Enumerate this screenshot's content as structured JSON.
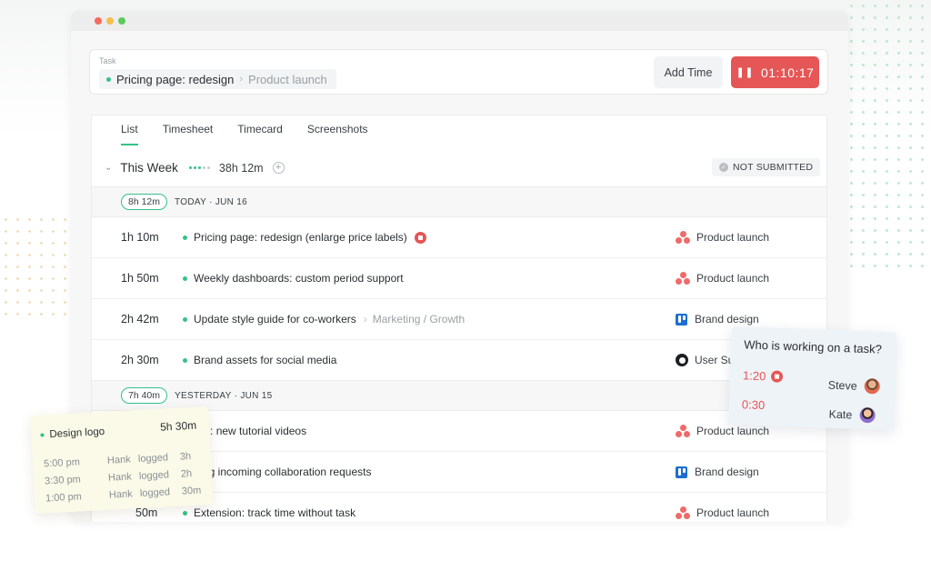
{
  "task": {
    "label": "Task",
    "name": "Pricing page: redesign",
    "project": "Product launch",
    "add_time_label": "Add Time",
    "timer_value": "01:10:17"
  },
  "tabs": [
    {
      "label": "List",
      "active": true
    },
    {
      "label": "Timesheet",
      "active": false
    },
    {
      "label": "Timecard",
      "active": false
    },
    {
      "label": "Screenshots",
      "active": false
    }
  ],
  "week": {
    "title": "This Week",
    "total": "38h 12m",
    "status": "NOT SUBMITTED"
  },
  "days": [
    {
      "total": "8h 12m",
      "label": "TODAY",
      "date": "JUN 16",
      "entries": [
        {
          "duration": "1h 10m",
          "description": "Pricing page: redesign (enlarge price labels)",
          "subtask": "",
          "running": true,
          "project": "Product launch",
          "project_icon": "asana-icon"
        },
        {
          "duration": "1h 50m",
          "description": "Weekly dashboards: custom period support",
          "subtask": "",
          "running": false,
          "project": "Product launch",
          "project_icon": "asana-icon"
        },
        {
          "duration": "2h 42m",
          "description": "Update style guide for co-workers",
          "subtask": "Marketing / Growth",
          "running": false,
          "project": "Brand design",
          "project_icon": "trello-icon"
        },
        {
          "duration": "2h 30m",
          "description": "Brand assets for social media",
          "subtask": "",
          "running": false,
          "project": "User Su",
          "project_icon": "github-icon"
        }
      ]
    },
    {
      "total": "7h 40m",
      "label": "YESTERDAY",
      "date": "JUN 15",
      "entries": [
        {
          "duration": "",
          "description": "utube: new tutorial videos",
          "subtask": "",
          "running": false,
          "project": "Product launch",
          "project_icon": "asana-icon"
        },
        {
          "duration": "",
          "description": "wering incoming collaboration requests",
          "subtask": "",
          "running": false,
          "project": "Brand design",
          "project_icon": "trello-icon"
        },
        {
          "duration": "50m",
          "description": "Extension: track time without task",
          "subtask": "",
          "running": false,
          "project": "Product launch",
          "project_icon": "asana-icon"
        }
      ]
    }
  ],
  "who_card": {
    "question": "Who is working on a task?",
    "people": [
      {
        "time": "1:20",
        "name": "Steve",
        "running": true
      },
      {
        "time": "0:30",
        "name": "Kate",
        "running": false
      }
    ]
  },
  "logo_card": {
    "task": "Design logo",
    "total": "5h 30m",
    "logs": [
      {
        "time": "5:00 pm",
        "user": "Hank",
        "action": "logged",
        "amount": "3h"
      },
      {
        "time": "3:30 pm",
        "user": "Hank",
        "action": "logged",
        "amount": "2h"
      },
      {
        "time": "1:00 pm",
        "user": "Hank",
        "action": "logged",
        "amount": "30m"
      }
    ]
  },
  "colors": {
    "accent": "#34c28a",
    "danger": "#e55656"
  }
}
